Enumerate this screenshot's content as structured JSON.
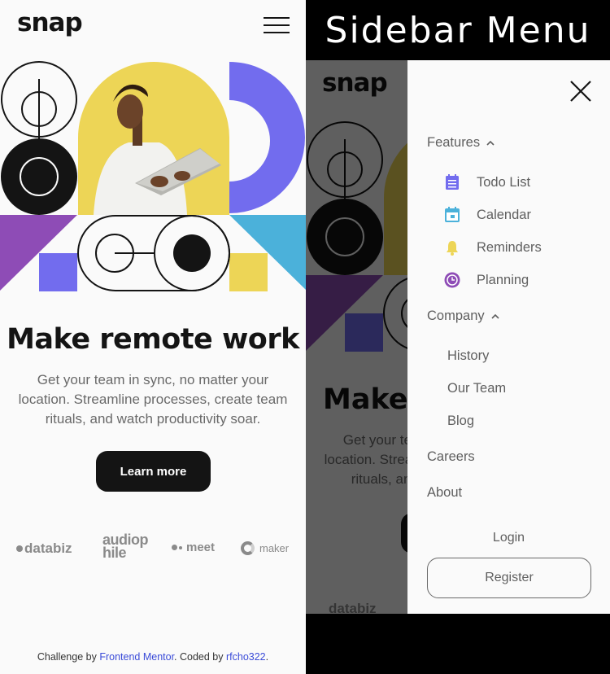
{
  "brand": {
    "logo": "snap"
  },
  "hero": {
    "headline": "Make remote work",
    "subtext": "Get your team in sync, no matter your location. Streamline processes, create team rituals, and watch productivity soar.",
    "cta_label": "Learn more"
  },
  "clients": [
    "databiz",
    "audiophile",
    "meet",
    "maker"
  ],
  "footer": {
    "prefix": "Challenge by ",
    "link1": "Frontend Mentor",
    "middle": ". Coded by ",
    "link2": "rfcho322",
    "suffix": "."
  },
  "overlay": {
    "title": "Sidebar Menu"
  },
  "sidebar": {
    "features": {
      "label": "Features",
      "items": [
        {
          "label": "Todo List",
          "icon": "todo-icon",
          "color": "#726cee"
        },
        {
          "label": "Calendar",
          "icon": "calendar-icon",
          "color": "#4bb1da"
        },
        {
          "label": "Reminders",
          "icon": "bell-icon",
          "color": "#edd556"
        },
        {
          "label": "Planning",
          "icon": "clock-icon",
          "color": "#8e4cb6"
        }
      ]
    },
    "company": {
      "label": "Company",
      "items": [
        "History",
        "Our Team",
        "Blog"
      ]
    },
    "careers": "Careers",
    "about": "About",
    "login": "Login",
    "register": "Register"
  },
  "colors": {
    "text_dark": "#141414",
    "text_gray": "#696969",
    "yellow": "#edd556",
    "purple": "#726cee",
    "blue": "#4bb1da",
    "violet": "#8e4cb6",
    "link": "#3a4bd8"
  }
}
